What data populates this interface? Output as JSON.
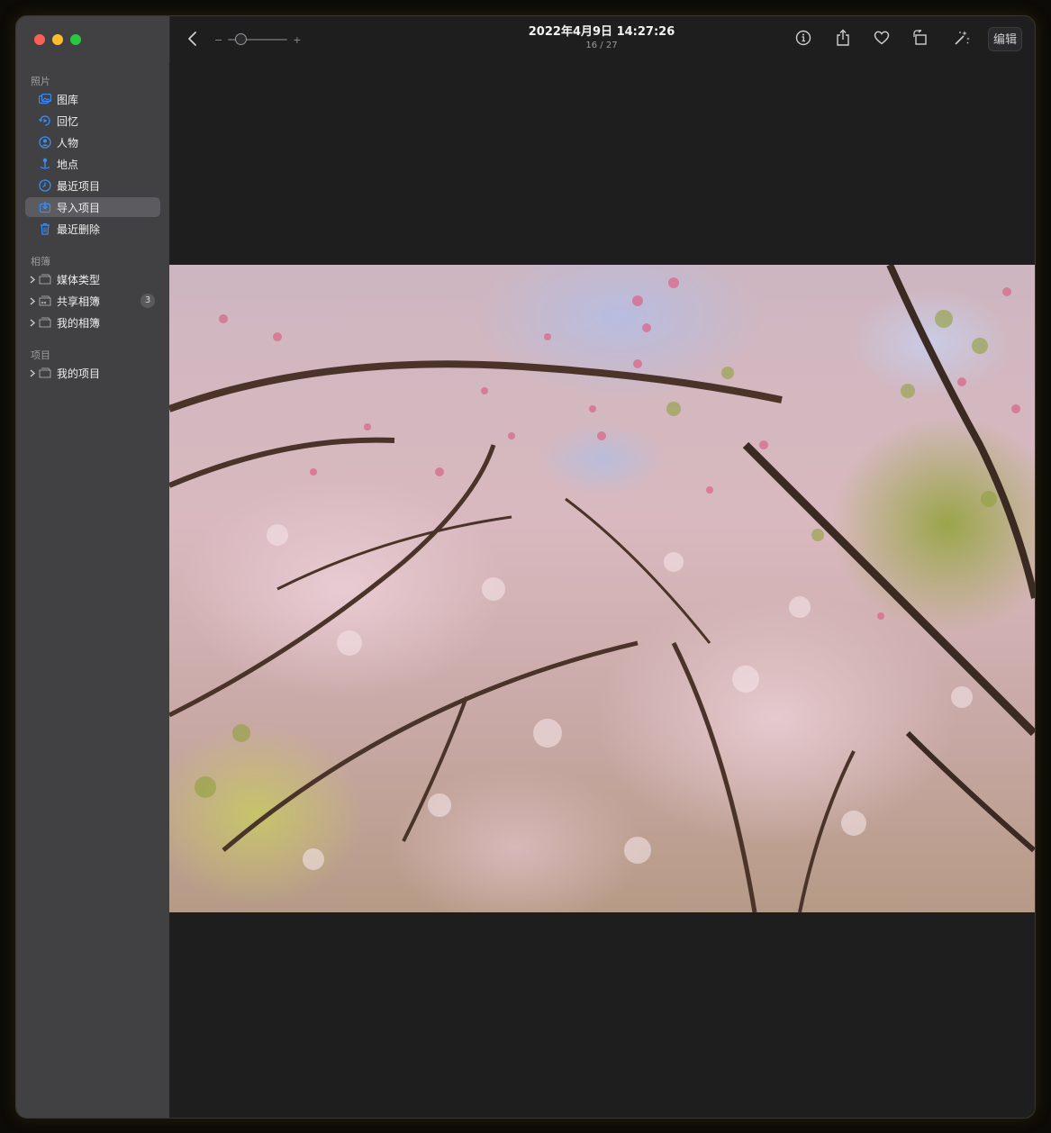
{
  "sidebar": {
    "sections": [
      {
        "title": "照片",
        "items": [
          {
            "label": "图库",
            "icon": "library-icon"
          },
          {
            "label": "回忆",
            "icon": "memories-icon"
          },
          {
            "label": "人物",
            "icon": "people-icon"
          },
          {
            "label": "地点",
            "icon": "places-icon"
          },
          {
            "label": "最近项目",
            "icon": "recents-icon"
          },
          {
            "label": "导入项目",
            "icon": "imports-icon",
            "selected": true
          },
          {
            "label": "最近删除",
            "icon": "trash-icon"
          }
        ]
      },
      {
        "title": "相簿",
        "items": [
          {
            "label": "媒体类型",
            "icon": "folder-icon"
          },
          {
            "label": "共享相簿",
            "icon": "shared-folder-icon",
            "badge": "3"
          },
          {
            "label": "我的相簿",
            "icon": "folder-icon"
          }
        ]
      },
      {
        "title": "项目",
        "items": [
          {
            "label": "我的项目",
            "icon": "folder-icon"
          }
        ]
      }
    ]
  },
  "toolbar": {
    "date": "2022年4月9日 14:27:26",
    "count": "16 / 27",
    "zoom_minus": "−",
    "zoom_plus": "+",
    "edit_label": "编辑"
  },
  "colors": {
    "accent": "#3b8cf5",
    "sidebar_bg": "#414143",
    "viewer_bg": "#1e1e1f",
    "selected_bg": "#5c5c60"
  }
}
